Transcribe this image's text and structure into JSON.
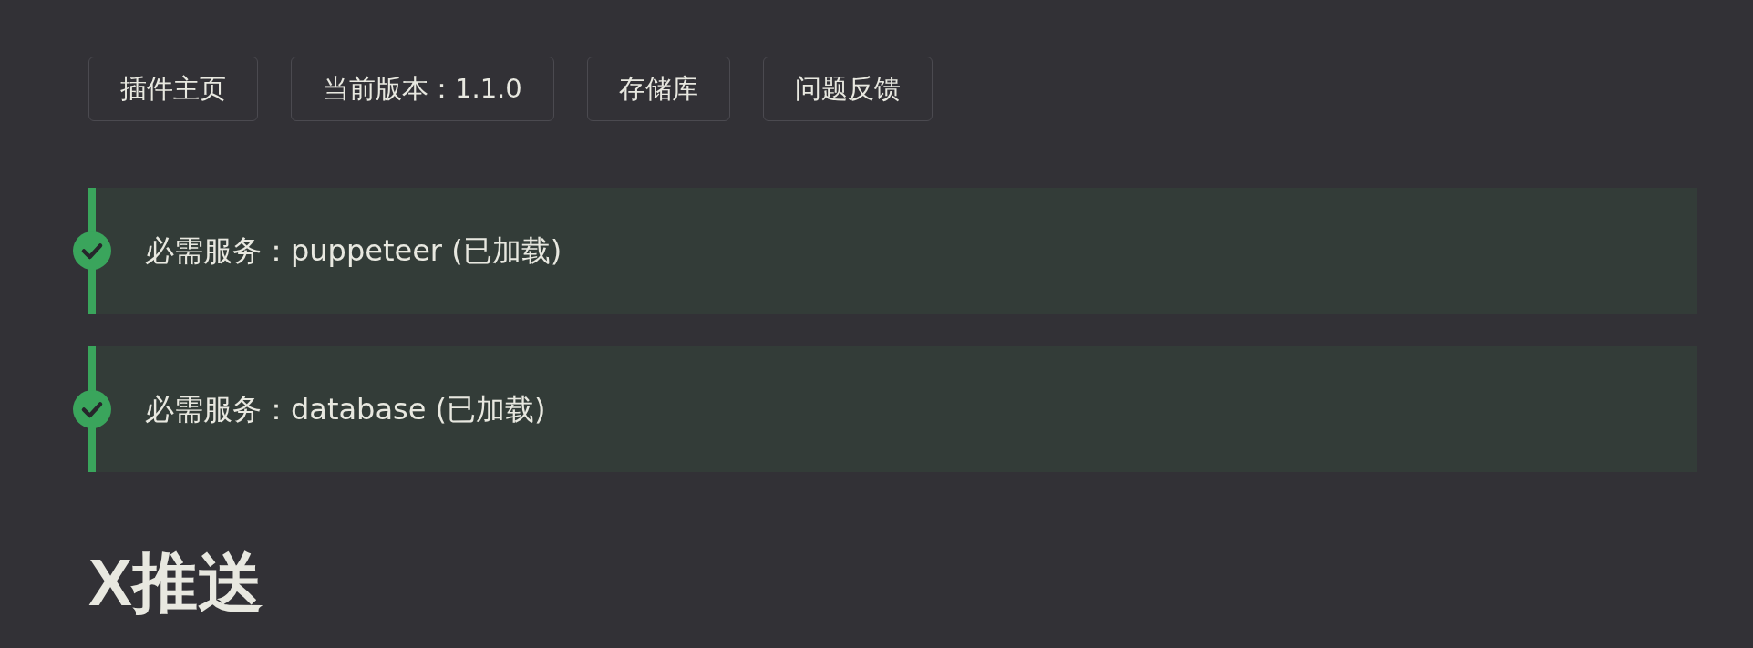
{
  "links": [
    {
      "label": "插件主页"
    },
    {
      "label": "当前版本：1.1.0"
    },
    {
      "label": "存储库"
    },
    {
      "label": "问题反馈"
    }
  ],
  "services": [
    {
      "kind": "success",
      "text": "必需服务：puppeteer (已加载)"
    },
    {
      "kind": "success",
      "text": "必需服务：database (已加载)"
    }
  ],
  "section": {
    "title": "X推送"
  }
}
